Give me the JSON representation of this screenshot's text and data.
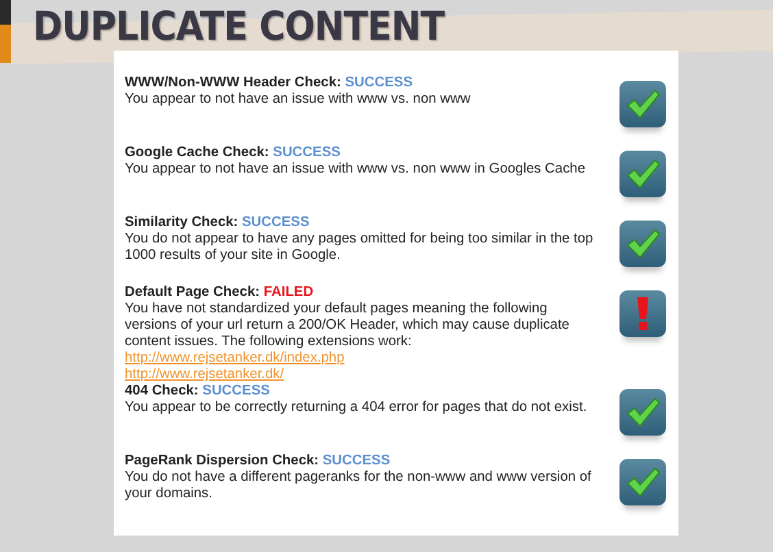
{
  "page_title": "DUPLICATE CONTENT",
  "checks": [
    {
      "title": "WWW/Non-WWW Header Check:",
      "status": "SUCCESS",
      "kind": "success",
      "description": "You appear to not have an issue with www vs. non www"
    },
    {
      "title": "Google Cache Check:",
      "status": "SUCCESS",
      "kind": "success",
      "description": "You appear to not have an issue with www vs. non www in Googles Cache"
    },
    {
      "title": "Similarity Check:",
      "status": "SUCCESS",
      "kind": "success",
      "description": "You do not appear to have any pages omitted for being too similar in the top 1000 results of your site in Google."
    },
    {
      "title": "Default Page Check:",
      "status": "FAILED",
      "kind": "failed",
      "description": "You have not standardized your default pages meaning the following versions of your url return a 200/OK Header, which may cause duplicate content issues. The following extensions work:",
      "links": [
        "http://www.rejsetanker.dk/index.php",
        "http://www.rejsetanker.dk/"
      ]
    },
    {
      "title": "404 Check:",
      "status": "SUCCESS",
      "kind": "success",
      "description": "You appear to be correctly returning a 404 error for pages that do not exist."
    },
    {
      "title": "PageRank Dispersion Check:",
      "status": "SUCCESS",
      "kind": "success",
      "description": "You do not have a different pageranks for the non-www and www version of your domains."
    }
  ]
}
